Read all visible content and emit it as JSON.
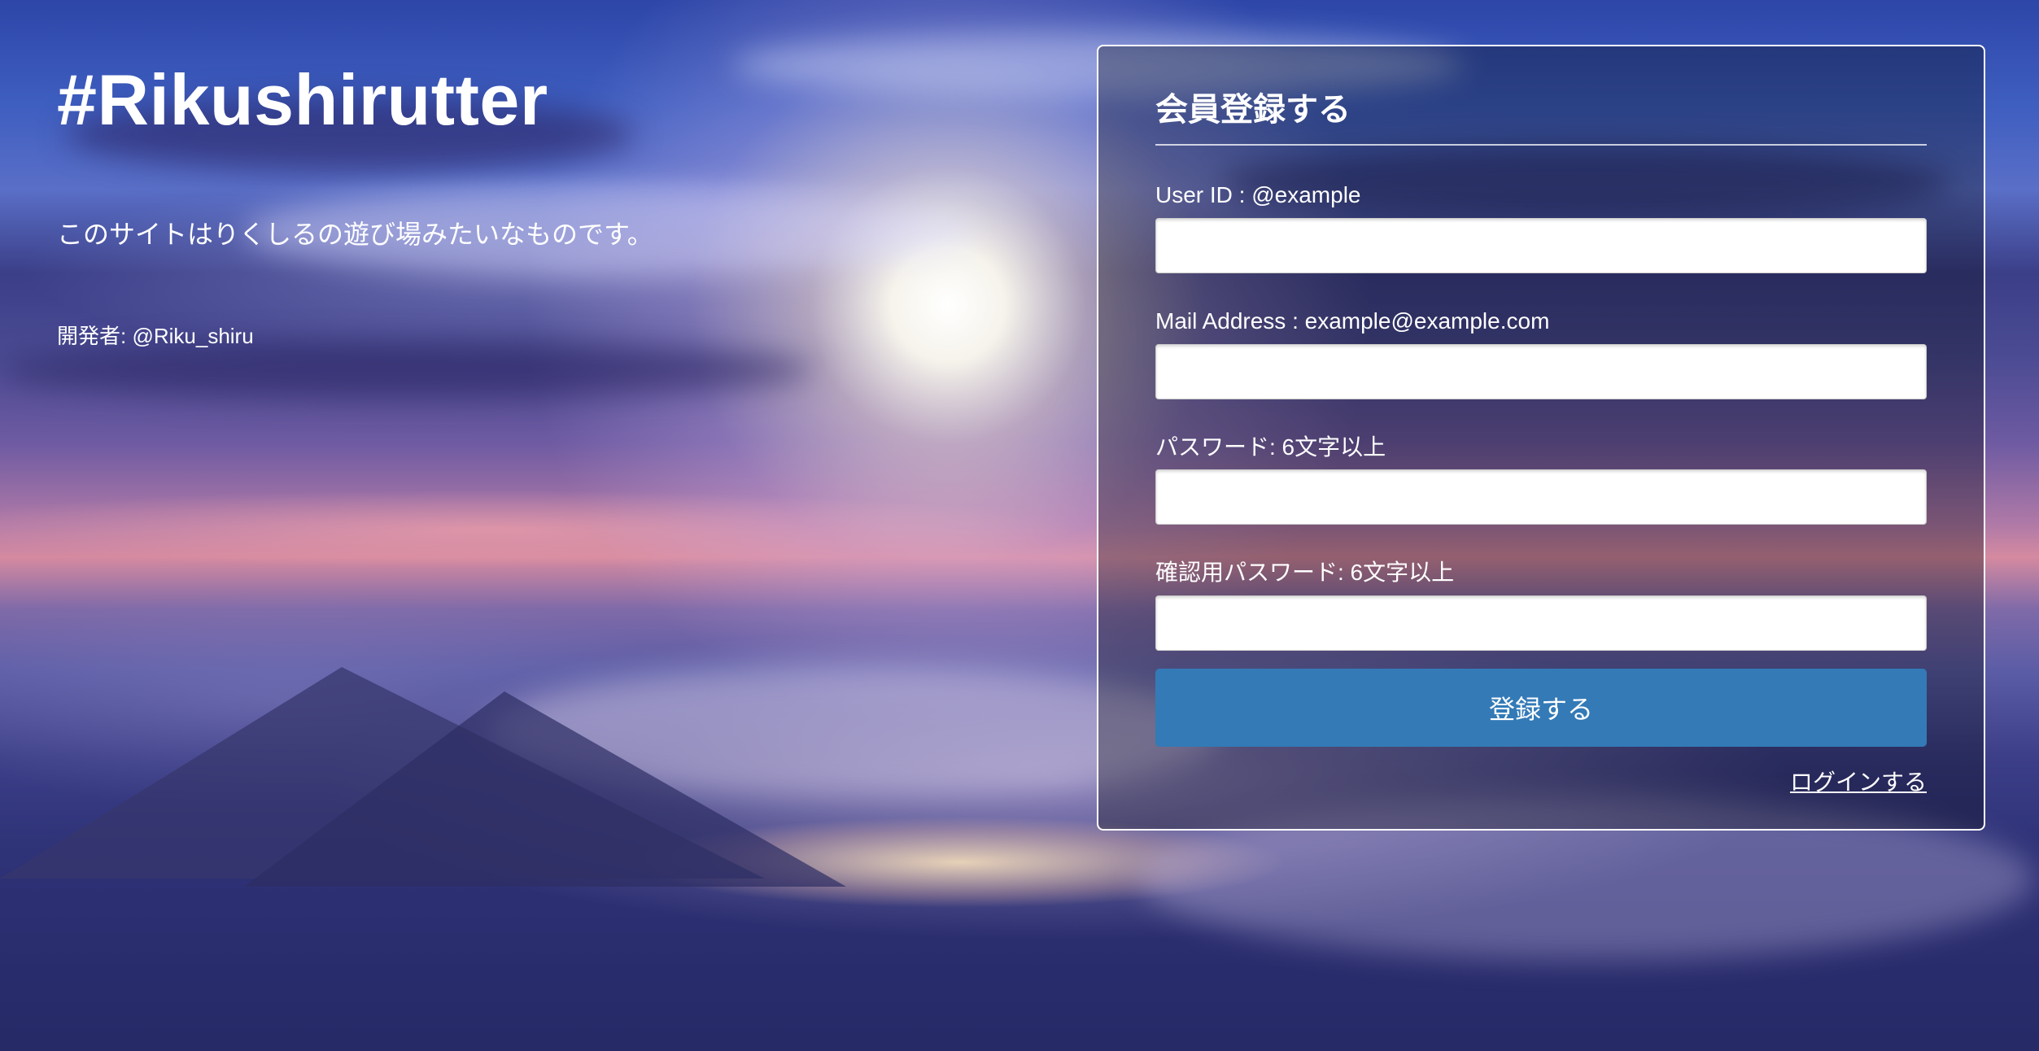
{
  "hero": {
    "title": "#Rikushirutter",
    "tagline": "このサイトはりくしるの遊び場みたいなものです。",
    "developer": "開発者: @Riku_shiru"
  },
  "signup": {
    "heading": "会員登録する",
    "fields": [
      {
        "label": "User ID : @example",
        "value": ""
      },
      {
        "label": "Mail Address : example@example.com",
        "value": ""
      },
      {
        "label": "パスワード: 6文字以上",
        "value": ""
      },
      {
        "label": "確認用パスワード: 6文字以上",
        "value": ""
      }
    ],
    "submit_label": "登録する",
    "login_link": "ログインする"
  },
  "colors": {
    "primary_button": "#337ab7",
    "panel_border": "#ffffff",
    "text": "#ffffff"
  }
}
